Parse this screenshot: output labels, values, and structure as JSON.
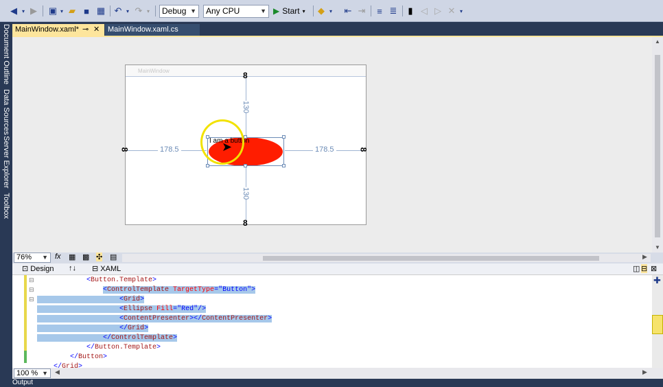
{
  "toolbar": {
    "config_value": "Debug",
    "platform_value": "Any CPU",
    "start_label": "Start"
  },
  "left_tabs": [
    "Document Outline",
    "Data Sources",
    "Server Explorer",
    "Toolbox"
  ],
  "tabs": [
    {
      "label": "MainWindow.xaml*"
    },
    {
      "label": "MainWindow.xaml.cs"
    }
  ],
  "designer": {
    "window_title": "MainWindow",
    "margin_left": "178.5",
    "margin_right": "178.5",
    "margin_top": "130",
    "margin_bottom": "130",
    "button_text": "I am a button",
    "zoom": "76%"
  },
  "split": {
    "design_label": "Design",
    "xaml_label": "XAML",
    "swap_icon": "↑↓"
  },
  "code_lines": [
    {
      "indent": "            ",
      "parts": [
        [
          "br",
          "<"
        ],
        [
          "tag",
          "Button.Template"
        ],
        [
          "br",
          ">"
        ]
      ],
      "selected": false
    },
    {
      "indent": "                ",
      "parts": [
        [
          "br",
          "<"
        ],
        [
          "tag",
          "ControlTemplate "
        ],
        [
          "attr",
          "TargetType"
        ],
        [
          "br",
          "="
        ],
        [
          "val",
          "\"Button\""
        ],
        [
          "br",
          ">"
        ]
      ],
      "selected": true
    },
    {
      "indent": "                    ",
      "parts": [
        [
          "br",
          "<"
        ],
        [
          "tag",
          "Grid"
        ],
        [
          "br",
          ">"
        ]
      ],
      "selected": true
    },
    {
      "indent": "                    ",
      "parts": [
        [
          "br",
          "<"
        ],
        [
          "tag",
          "Ellipse "
        ],
        [
          "attr",
          "Fill"
        ],
        [
          "br",
          "="
        ],
        [
          "val",
          "\"Red\""
        ],
        [
          "br",
          "/>"
        ]
      ],
      "selected": true
    },
    {
      "indent": "                    ",
      "parts": [
        [
          "br",
          "<"
        ],
        [
          "tag",
          "ContentPresenter"
        ],
        [
          "br",
          "></"
        ],
        [
          "tag",
          "ContentPresenter"
        ],
        [
          "br",
          ">"
        ]
      ],
      "selected": true
    },
    {
      "indent": "                    ",
      "parts": [
        [
          "br",
          "</"
        ],
        [
          "tag",
          "Grid"
        ],
        [
          "br",
          ">"
        ]
      ],
      "selected": true
    },
    {
      "indent": "                ",
      "parts": [
        [
          "br",
          "</"
        ],
        [
          "tag",
          "ControlTemplate"
        ],
        [
          "br",
          ">"
        ]
      ],
      "selected": true
    },
    {
      "indent": "            ",
      "parts": [
        [
          "br",
          "</"
        ],
        [
          "tag",
          "Button.Template"
        ],
        [
          "br",
          ">"
        ]
      ],
      "selected": false
    },
    {
      "indent": "        ",
      "parts": [
        [
          "br",
          "</"
        ],
        [
          "tag",
          "Button"
        ],
        [
          "br",
          ">"
        ]
      ],
      "selected": false
    },
    {
      "indent": "    ",
      "parts": [
        [
          "br",
          "</"
        ],
        [
          "tag",
          "Grid"
        ],
        [
          "br",
          ">"
        ]
      ],
      "selected": false
    }
  ],
  "editor_zoom": "100 %",
  "bottom_label": "Output"
}
